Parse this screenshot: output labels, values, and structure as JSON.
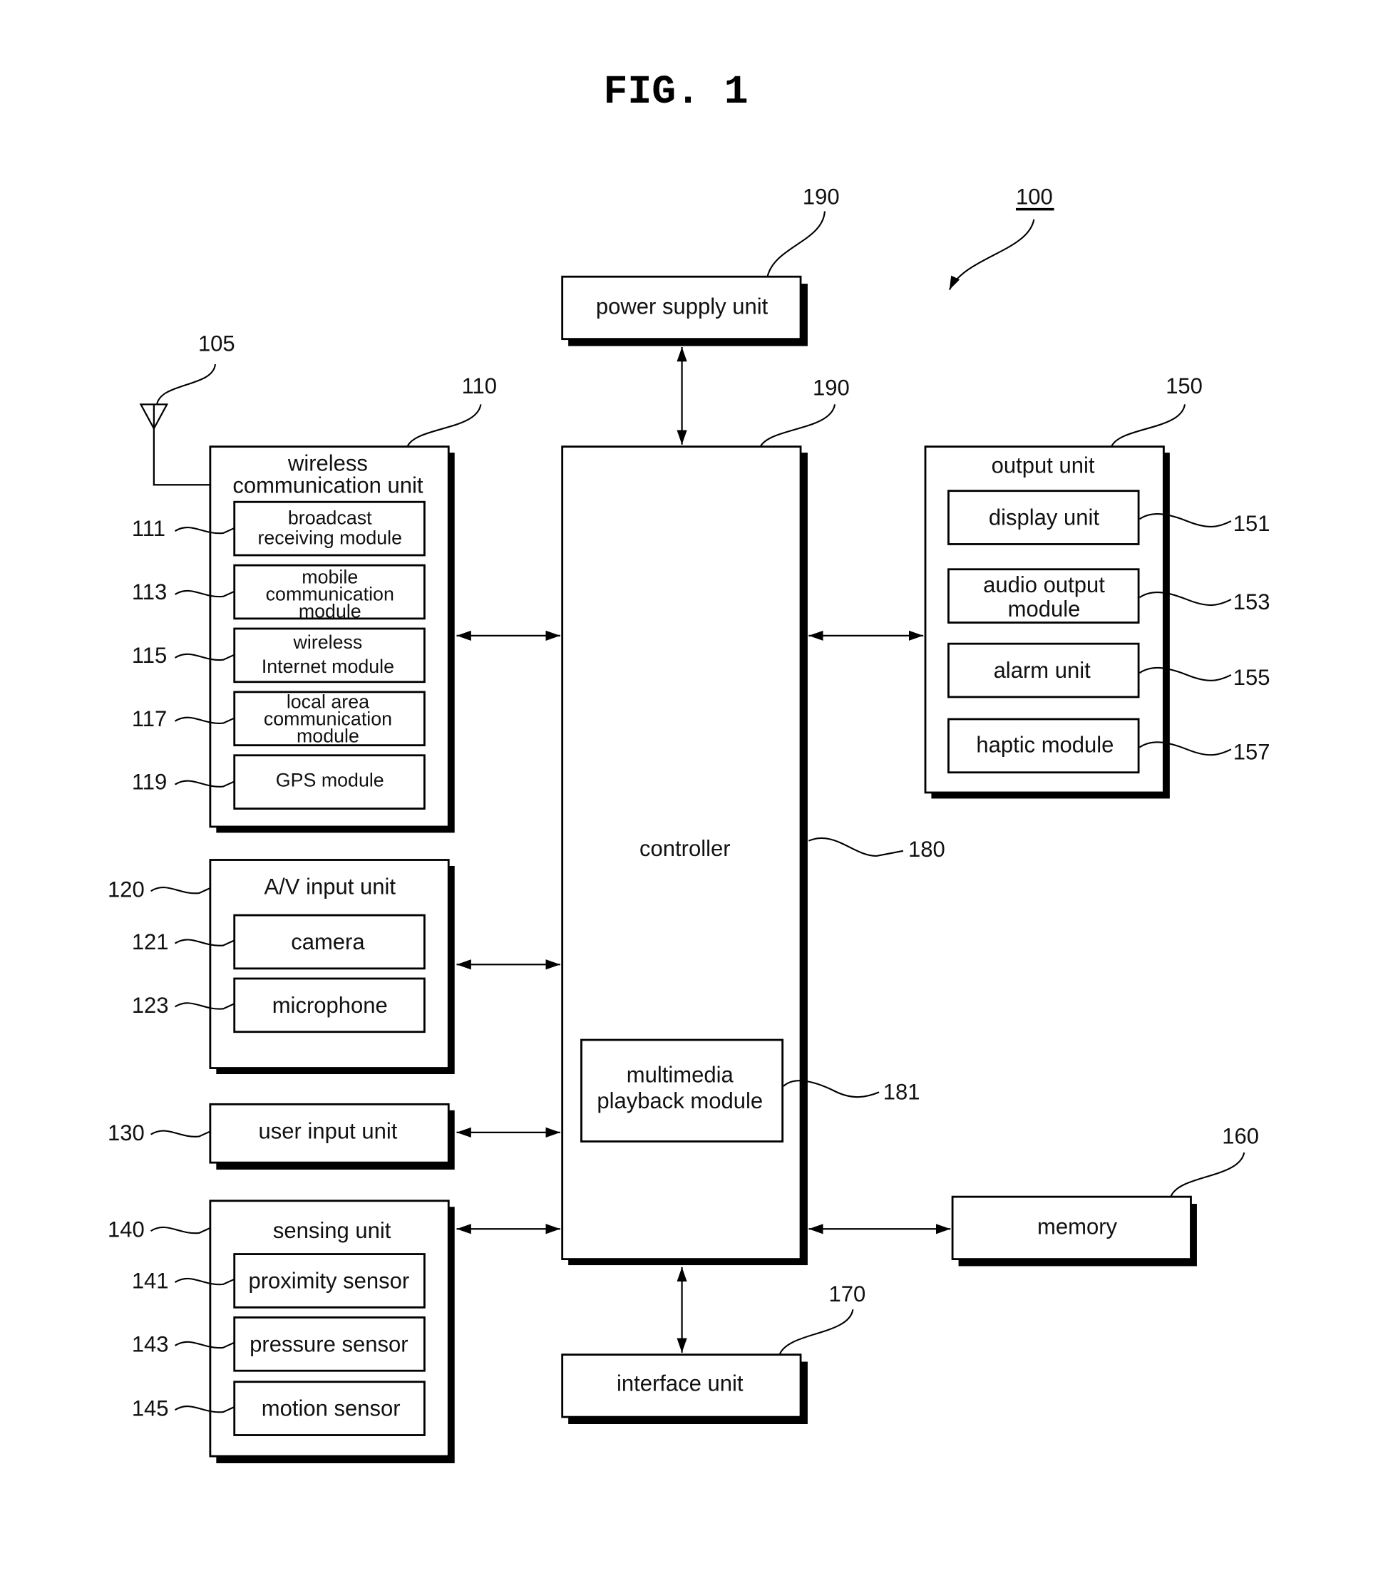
{
  "figure": {
    "title": "FIG. 1",
    "device_ref": "100"
  },
  "power_supply": {
    "label": "power supply unit",
    "ref": "190"
  },
  "controller": {
    "label": "controller",
    "ref": "180",
    "top_ref": "190",
    "multimedia": {
      "line1": "multimedia",
      "line2": "playback module",
      "ref": "181"
    }
  },
  "antenna": {
    "ref": "105"
  },
  "wireless": {
    "line1": "wireless",
    "line2": "communication unit",
    "ref": "110",
    "modules": [
      {
        "ref": "111",
        "lines": [
          "broadcast",
          "receiving module"
        ]
      },
      {
        "ref": "113",
        "lines": [
          "mobile",
          "communication",
          "module"
        ]
      },
      {
        "ref": "115",
        "lines": [
          "wireless",
          "Internet module"
        ]
      },
      {
        "ref": "117",
        "lines": [
          "local area",
          "communication",
          "module"
        ]
      },
      {
        "ref": "119",
        "lines": [
          "GPS module"
        ]
      }
    ]
  },
  "av_input": {
    "label": "A/V input unit",
    "ref": "120",
    "modules": [
      {
        "ref": "121",
        "label": "camera"
      },
      {
        "ref": "123",
        "label": "microphone"
      }
    ]
  },
  "user_input": {
    "label": "user input unit",
    "ref": "130"
  },
  "sensing": {
    "label": "sensing unit",
    "ref": "140",
    "modules": [
      {
        "ref": "141",
        "label": "proximity sensor"
      },
      {
        "ref": "143",
        "label": "pressure sensor"
      },
      {
        "ref": "145",
        "label": "motion sensor"
      }
    ]
  },
  "output": {
    "label": "output unit",
    "ref": "150",
    "modules": [
      {
        "ref": "151",
        "lines": [
          "display unit"
        ]
      },
      {
        "ref": "153",
        "lines": [
          "audio output",
          "module"
        ]
      },
      {
        "ref": "155",
        "lines": [
          "alarm unit"
        ]
      },
      {
        "ref": "157",
        "lines": [
          "haptic module"
        ]
      }
    ]
  },
  "memory": {
    "label": "memory",
    "ref": "160"
  },
  "interface": {
    "label": "interface unit",
    "ref": "170"
  }
}
